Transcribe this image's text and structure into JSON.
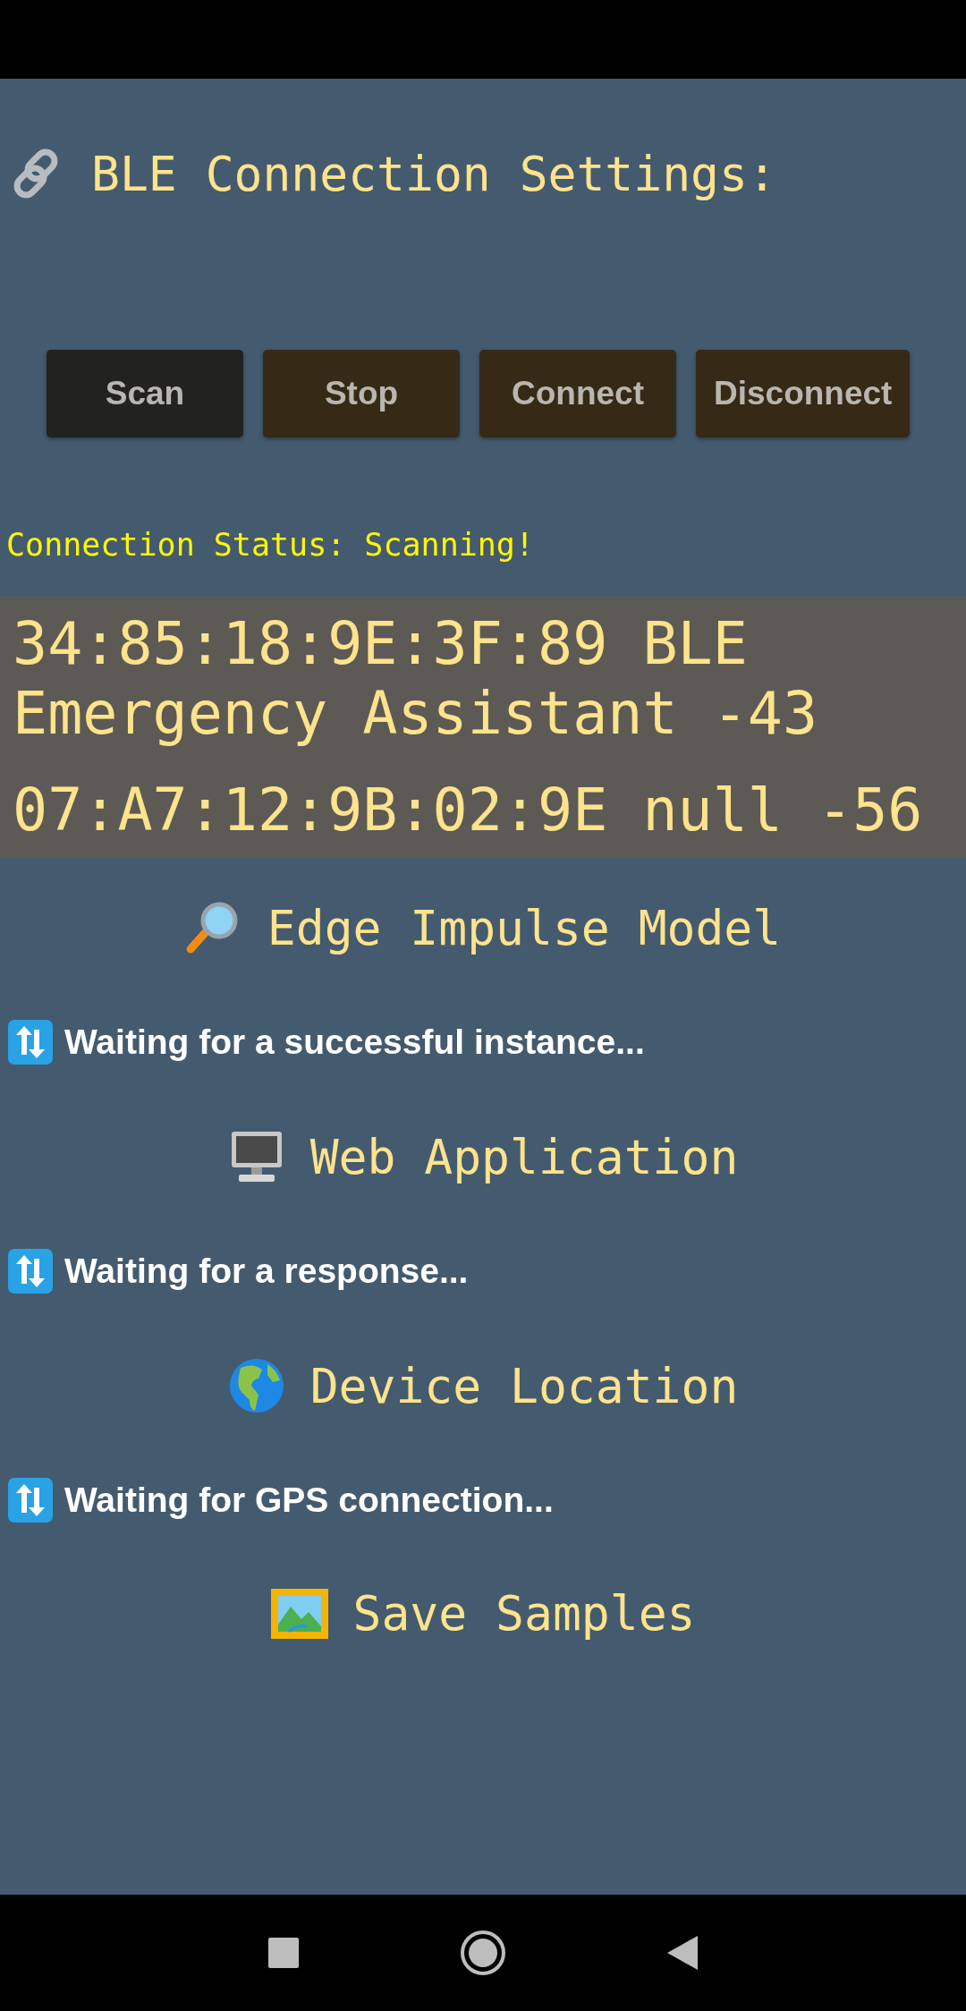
{
  "ble": {
    "title": "BLE Connection Settings:",
    "buttons": [
      {
        "label": "Scan",
        "selected": true
      },
      {
        "label": "Stop",
        "selected": false
      },
      {
        "label": "Connect",
        "selected": false
      },
      {
        "label": "Disconnect",
        "selected": false
      }
    ],
    "status": "Connection Status: Scanning!",
    "devices": [
      "34:85:18:9E:3F:89 BLE Emergency Assistant -43",
      "07:A7:12:9B:02:9E null -56"
    ]
  },
  "sections": [
    {
      "kind": "magnifier",
      "title": "Edge Impulse Model",
      "message": "Waiting for a successful instance..."
    },
    {
      "kind": "computer",
      "title": "Web Application",
      "message": "Waiting for a response..."
    },
    {
      "kind": "globe",
      "title": "Device Location",
      "message": "Waiting for GPS connection..."
    },
    {
      "kind": "picture-frame",
      "title": "Save Samples"
    }
  ]
}
